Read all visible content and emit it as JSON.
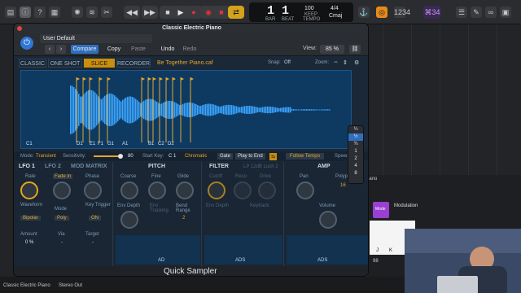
{
  "transport": {
    "bar": "1",
    "beat": "1",
    "bar_label": "BAR",
    "beat_label": "BEAT",
    "tempo": "100",
    "tempo_label": "KEEP",
    "tempo_sub": "TEMPO",
    "sig": "4/4",
    "key": "Cmaj"
  },
  "badge": "⌘34",
  "plugin": {
    "title": "Classic Electric Piano",
    "preset": "User Default",
    "compare": "Compare",
    "copy": "Copy",
    "paste": "Paste",
    "undo": "Undo",
    "redo": "Redo",
    "view_label": "View:",
    "view_value": "85 %"
  },
  "sampler": {
    "tabs": [
      "CLASSIC",
      "ONE SHOT",
      "SLICE",
      "RECORDER"
    ],
    "sample_name": "Be Together Piano.caf",
    "snap_label": "Snap:",
    "snap_value": "Off",
    "zoom_label": "Zoom:",
    "markers": [
      "C1",
      "D1",
      "E1",
      "F1",
      "G1",
      "A1",
      "B1",
      "C2",
      "D2"
    ],
    "mode_label": "Mode:",
    "mode_value": "Transient",
    "sens_label": "Sensitivity:",
    "sens_value": "80",
    "startkey_label": "Start Key:",
    "startkey_value": "C 1",
    "scale_value": "Chromatic",
    "gate": "Gate",
    "play_to_end": "Play to End",
    "follow_tempo": "Follow Tempo",
    "speed_label": "Speed"
  },
  "speed_options": [
    "¼",
    "½",
    "¾",
    "1",
    "2",
    "4",
    "8"
  ],
  "speed_selected_index": 1,
  "mod": {
    "lfo1": "LFO 1",
    "lfo2": "LFO 2",
    "matrix": "MOD MATRIX",
    "rate": "Rate",
    "fade_in": "Fade In",
    "phase": "Phase",
    "waveform": "Waveform",
    "waveform_value": "Bipolar",
    "mode": "Mode",
    "mode_value": "Poly",
    "key_trigger": "Key Trigger",
    "key_trigger_value": "ON",
    "amount": "Amount",
    "amount_value": "0 %",
    "via": "Via",
    "via_value": "-",
    "target": "Target",
    "target_value": "-"
  },
  "pitch": {
    "title": "PITCH",
    "coarse": "Coarse",
    "fine": "Fine",
    "glide": "Glide",
    "env_depth": "Env Depth",
    "env_tracking": "Env\nTracking",
    "bend_range": "Bend Range",
    "bend_value": "2"
  },
  "filter": {
    "title": "FILTER",
    "type": "LP 12dB Lush 2",
    "cutoff": "Cutoff",
    "reso": "Reso",
    "drive": "Drive",
    "env_depth": "Env Depth",
    "keytrack": "Keytrack"
  },
  "amp": {
    "title": "AMP",
    "pan": "Pan",
    "polyphony": "Polyph",
    "poly_value": "16",
    "volume": "Volume"
  },
  "env": {
    "ad": "AD",
    "ads": "ADS",
    "adsr": "ADS"
  },
  "footer": {
    "plugin_name": "Quick Sampler"
  },
  "tracks": {
    "left": "Classic Electric Piano",
    "right": "Stereo Out"
  },
  "side": {
    "piano": "iano",
    "modulation": "Modulation",
    "mode": "Mode",
    "j": "J",
    "k": "K",
    "n98": "98"
  }
}
